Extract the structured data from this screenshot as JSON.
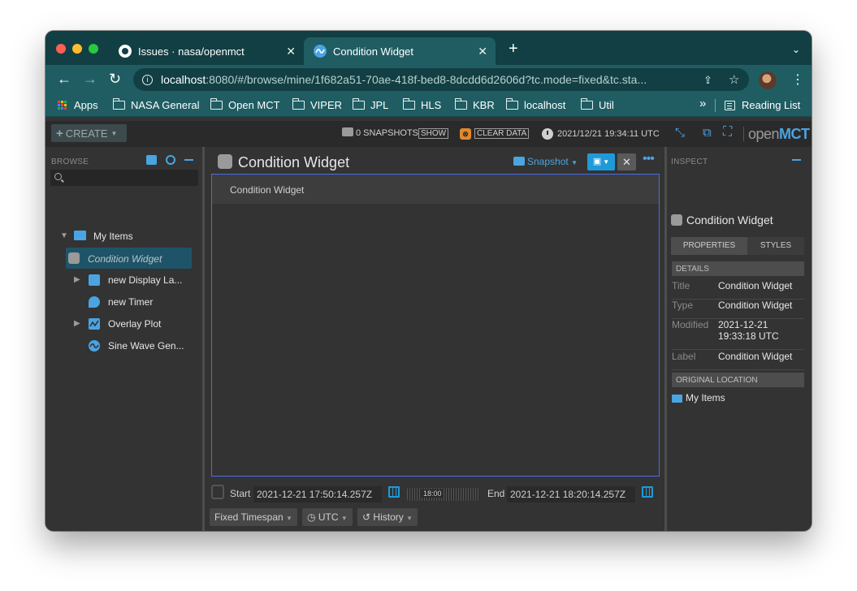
{
  "browser": {
    "tabs": [
      {
        "title": "Issues · nasa/openmct",
        "icon": "github-icon"
      },
      {
        "title": "Condition Widget",
        "icon": "openmct-icon",
        "active": true
      }
    ],
    "url_host": "localhost",
    "url_rest": ":8080/#/browse/mine/1f682a51-70ae-418f-bed8-8dcdd6d2606d?tc.mode=fixed&tc.sta...",
    "bookmarks": [
      "Apps",
      "NASA General",
      "Open MCT",
      "VIPER",
      "JPL",
      "HLS",
      "KBR",
      "localhost",
      "Util"
    ],
    "more_bookmarks": "»",
    "reading_list": "Reading List"
  },
  "header": {
    "create_label": "CREATE",
    "snapshots_text": "0 SNAPSHOTS",
    "show_label": "SHOW",
    "clear_data_label": "CLEAR DATA",
    "clock_text": "2021/12/21 19:34:11 UTC",
    "logo_open": "open",
    "logo_mct": "MCT"
  },
  "browse": {
    "label": "BROWSE",
    "tree": {
      "root": "My Items",
      "items": [
        {
          "label": "Condition Widget",
          "icon": "condition-widget-icon",
          "selected": true
        },
        {
          "label": "new Display La...",
          "icon": "display-layout-icon",
          "expandable": true
        },
        {
          "label": "new Timer",
          "icon": "timer-icon"
        },
        {
          "label": "Overlay Plot",
          "icon": "overlay-plot-icon",
          "expandable": true
        },
        {
          "label": "Sine Wave Gen...",
          "icon": "sine-wave-icon"
        }
      ]
    }
  },
  "main": {
    "title": "Condition Widget",
    "snapshot_label": "Snapshot",
    "widget_label": "Condition Widget",
    "time": {
      "start_label": "Start",
      "start_value": "2021-12-21 17:50:14.257Z",
      "end_label": "End",
      "end_value": "2021-12-21 18:20:14.257Z",
      "slider_label": "18:00",
      "mode": "Fixed Timespan",
      "timezone": "UTC",
      "history": "History"
    }
  },
  "inspect": {
    "label": "INSPECT",
    "title": "Condition Widget",
    "tabs": [
      "PROPERTIES",
      "STYLES"
    ],
    "details_header": "DETAILS",
    "properties": [
      {
        "key": "Title",
        "value": "Condition Widget"
      },
      {
        "key": "Type",
        "value": "Condition Widget"
      },
      {
        "key": "Modified",
        "value": "2021-12-21 19:33:18 UTC"
      },
      {
        "key": "Label",
        "value": "Condition Widget"
      }
    ],
    "location_header": "ORIGINAL LOCATION",
    "location": "My Items"
  },
  "colors": {
    "tabstrip": "#123f43",
    "toolbar": "#1f5d63",
    "accent": "#4aa4e1",
    "selection": "#1f5468",
    "frame_border": "#4a6de5"
  }
}
